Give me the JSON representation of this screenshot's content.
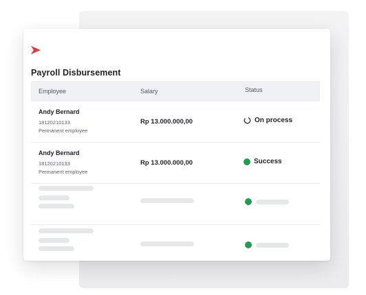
{
  "page": {
    "title": "Payroll Disbursement"
  },
  "table": {
    "columns": [
      "Employee",
      "Salary",
      "Status"
    ],
    "rows": [
      {
        "name": "Andy Bernard",
        "id": "18120210133",
        "type": "Permanent employee",
        "salary": "Rp 13.000.000,00",
        "status": "On process",
        "status_icon": "loading-spinner-icon"
      },
      {
        "name": "Andy Bernard",
        "id": "18120210133",
        "type": "Permanent employee",
        "salary": "Rp 13.000.000,00",
        "status": "Success",
        "status_icon": "success-dot-icon"
      }
    ]
  },
  "colors": {
    "brand": "#e8343c",
    "success": "#1f9d55",
    "header_bg": "#eef0f3",
    "skeleton": "#e6e7ea"
  }
}
